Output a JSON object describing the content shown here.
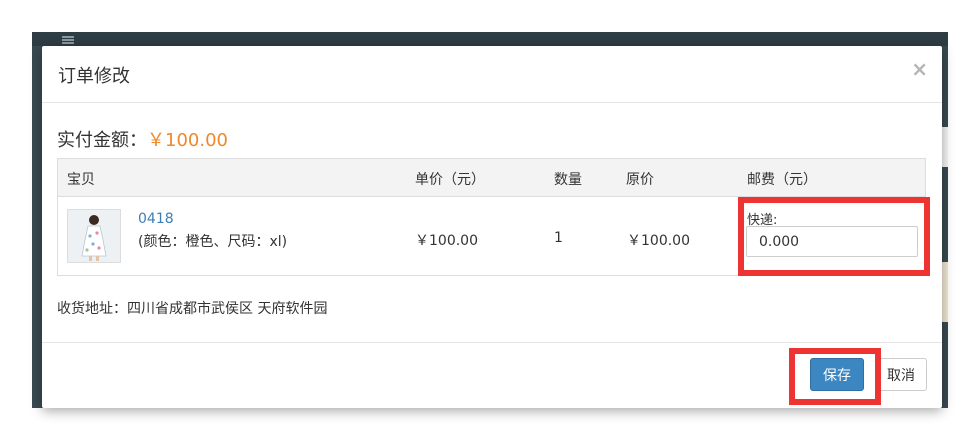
{
  "modal": {
    "title": "订单修改",
    "close_symbol": "×"
  },
  "paid": {
    "label": "实付金额：",
    "amount": "￥100.00"
  },
  "table": {
    "headers": {
      "item": "宝贝",
      "unit_price": "单价（元）",
      "quantity": "数量",
      "original_price": "原价",
      "shipping": "邮费（元）"
    },
    "row": {
      "product_link": "0418",
      "spec": "(颜色：橙色、尺码：xl)",
      "unit_price": "￥100.00",
      "quantity": "1",
      "original_price": "￥100.00",
      "shipping_method": "快递:",
      "shipping_value": "0.000"
    }
  },
  "address": "收货地址：四川省成都市武侯区 天府软件园",
  "footer": {
    "save_label": "保存",
    "cancel_label": "取消"
  },
  "colors": {
    "accent_amount": "#f0882a",
    "link": "#3c7fb7",
    "primary_button": "#3c86c1",
    "highlight": "#ee3333"
  }
}
